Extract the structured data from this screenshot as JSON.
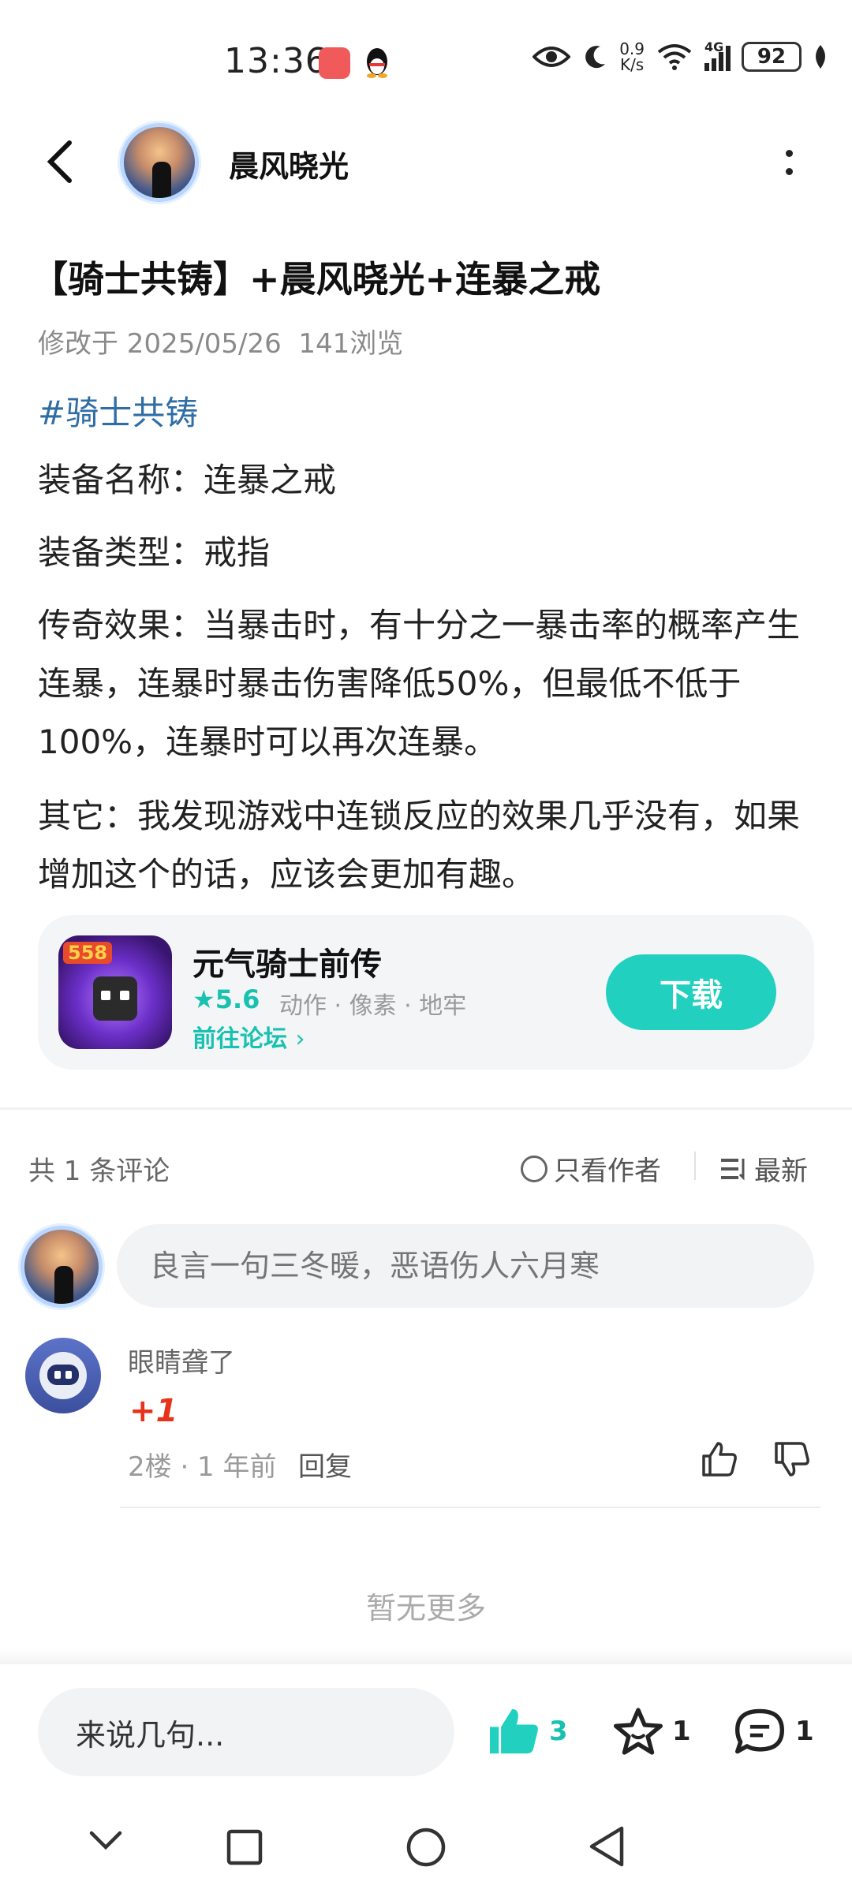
{
  "status_bar": {
    "time": "13:36",
    "net_speed_top": "0.9",
    "net_speed_bottom": "K/s",
    "network": "4G",
    "battery": "92"
  },
  "header": {
    "author_name": "晨风晓光"
  },
  "post": {
    "title": "【骑士共铸】+晨风晓光+连暴之戒",
    "meta": "修改于 2025/05/26  141浏览",
    "tag": "#骑士共铸",
    "lines": [
      "装备名称：连暴之戒",
      "装备类型：戒指",
      "传奇效果：当暴击时，有十分之一暴击率的概率产生连暴，连暴时暴击伤害降低50%，但最低不低于100%，连暴时可以再次连暴。",
      "其它：我发现游戏中连锁反应的效果几乎没有，如果增加这个的话，应该会更加有趣。"
    ]
  },
  "app_card": {
    "badge": "558",
    "name": "元气骑士前传",
    "rating": "5.6",
    "tags": "动作 · 像素 · 地牢",
    "forum_link": "前往论坛",
    "download_label": "下载"
  },
  "comments": {
    "count_label": "共 1 条评论",
    "only_author_label": "只看作者",
    "sort_label": "最新",
    "input_placeholder": "良言一句三冬暖，恶语伤人六月寒",
    "items": [
      {
        "username": "眼睛聋了",
        "content": "+1",
        "meta": "2楼 · 1 年前",
        "reply_label": "回复"
      }
    ],
    "no_more": "暂无更多"
  },
  "bottom_bar": {
    "say_placeholder": "来说几句...",
    "like_count": "3",
    "fav_count": "1",
    "comment_count": "1"
  },
  "colors": {
    "accent_teal": "#22d0c0",
    "tag_blue": "#2f6ea5",
    "plus_red": "#e8331c"
  }
}
